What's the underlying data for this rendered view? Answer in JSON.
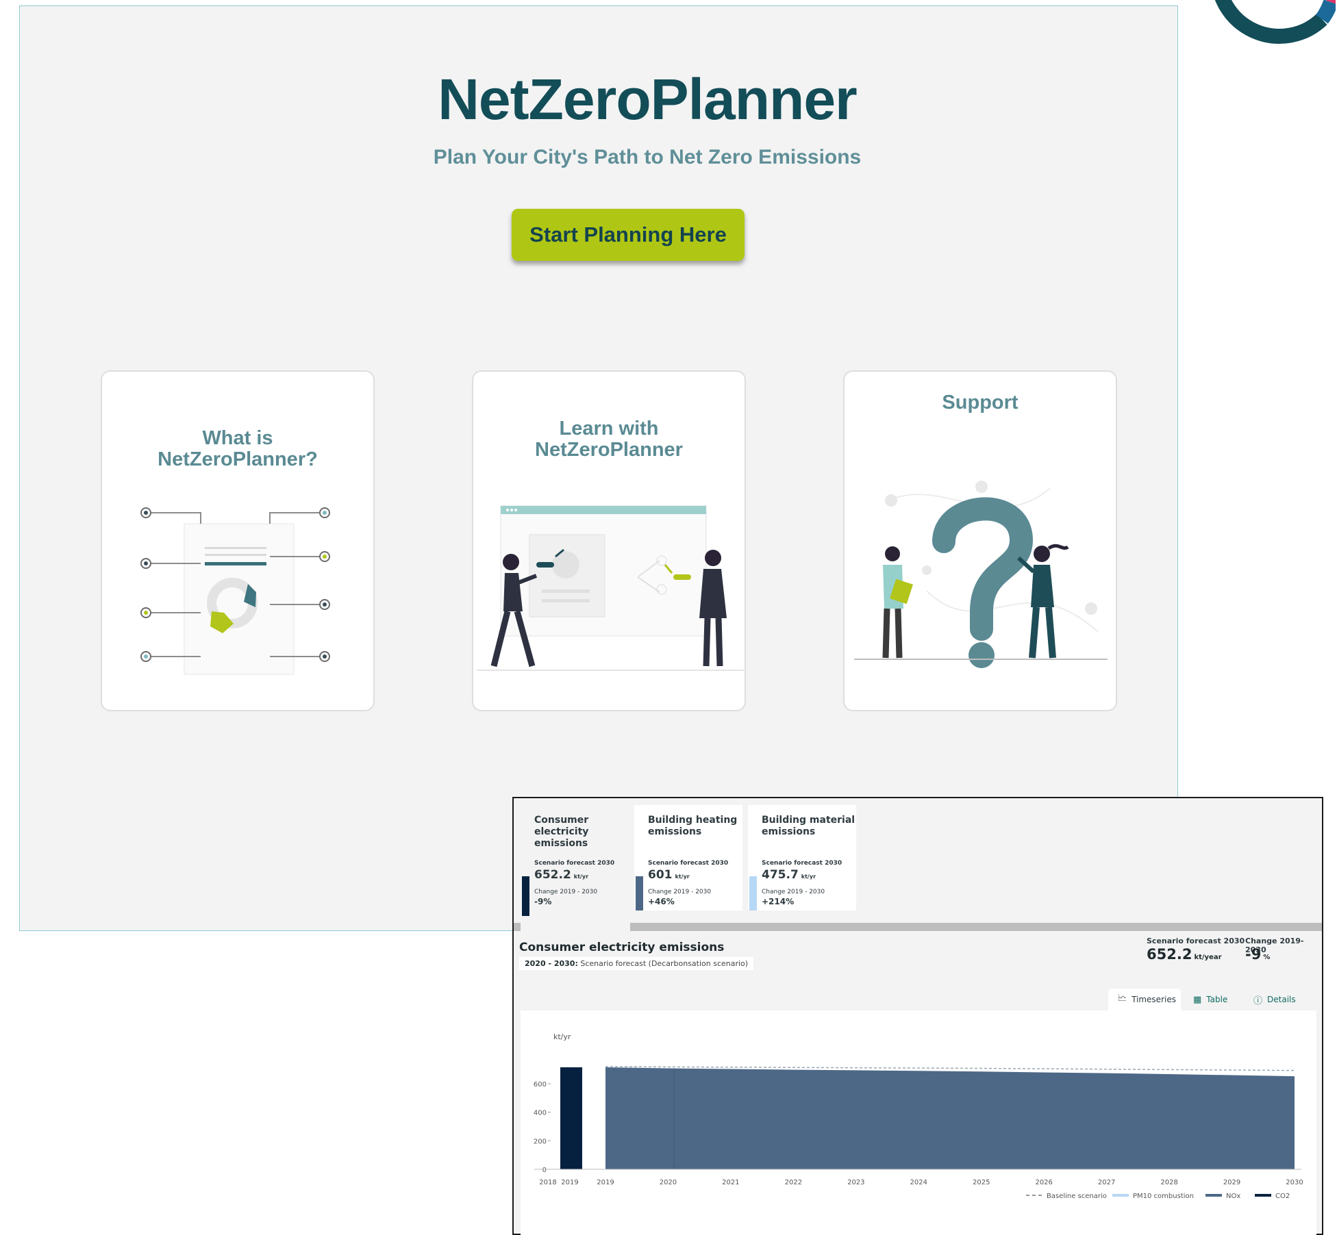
{
  "landing": {
    "title": "NetZeroPlanner",
    "subtitle": "Plan Your City's Path to Net Zero Emissions",
    "cta_label": "Start Planning Here",
    "cards": [
      {
        "title_line1": "What is",
        "title_line2": "NetZeroPlanner?"
      },
      {
        "title_line1": "Learn with",
        "title_line2": "NetZeroPlanner"
      },
      {
        "title_line1": "Support"
      }
    ]
  },
  "colors": {
    "brand_dark": "#134d58",
    "brand_muted": "#5a8a93",
    "accent_green": "#afc714",
    "logo_pink": "#e2336b",
    "logo_blue": "#1b6a9a",
    "series_co2": "#06213f",
    "series_nox": "#4d6886",
    "series_pm10": "#b7d8f5"
  },
  "dashboard": {
    "tiles": [
      {
        "name_l1": "Consumer",
        "name_l2": "electricity",
        "name_l3": "emissions",
        "forecast_label": "Scenario forecast 2030",
        "value": "652.2",
        "unit": "kt/yr",
        "change_label": "Change 2019 - 2030",
        "change": "-9%",
        "color": "#06213f"
      },
      {
        "name_l1": "Building heating",
        "name_l2": "emissions",
        "forecast_label": "Scenario forecast 2030",
        "value": "601",
        "unit": "kt/yr",
        "change_label": "Change 2019 - 2030",
        "change": "+46%",
        "color": "#4d6886"
      },
      {
        "name_l1": "Building material",
        "name_l2": "emissions",
        "forecast_label": "Scenario forecast 2030",
        "value": "475.7",
        "unit": "kt/yr",
        "change_label": "Change 2019 - 2030",
        "change": "+214%",
        "color": "#b7d8f5"
      }
    ],
    "section_title": "Consumer electricity emissions",
    "section_sub_bold": "2020 - 2030:",
    "section_sub_rest": "Scenario forecast (Decarbonsation scenario)",
    "forecast_label": "Scenario forecast 2030",
    "forecast_value": "652.2",
    "forecast_unit": "kt/year",
    "change_label": "Change 2019-2030",
    "change_value": "-9",
    "change_unit": "%",
    "tabs": [
      {
        "label": "Timeseries",
        "icon": "line-chart-icon"
      },
      {
        "label": "Table",
        "icon": "table-icon"
      },
      {
        "label": "Details",
        "icon": "info-icon"
      }
    ]
  },
  "chart_data": {
    "type": "area",
    "ylabel": "kt/yr",
    "ylim": [
      0,
      720
    ],
    "yticks": [
      0,
      200,
      400,
      600
    ],
    "historic": {
      "x_labels": [
        "2018",
        "2019"
      ],
      "values": [
        0,
        715
      ]
    },
    "x_labels": [
      "2019",
      "2020",
      "2021",
      "2022",
      "2023",
      "2024",
      "2025",
      "2026",
      "2027",
      "2028",
      "2029",
      "2030"
    ],
    "series": [
      {
        "name": "NOx",
        "values": [
          715,
          708,
          703,
          698,
          694,
          690,
          685,
          679,
          674,
          667,
          660,
          652
        ]
      },
      {
        "name": "Baseline scenario",
        "values": [
          715,
          713,
          711,
          709,
          707,
          705,
          703,
          700,
          697,
          694,
          691,
          688
        ]
      }
    ],
    "legend": [
      "Baseline scenario",
      "PM10 combustion",
      "NOx",
      "CO2"
    ],
    "legend_position": "bottom-right",
    "grid": false
  }
}
